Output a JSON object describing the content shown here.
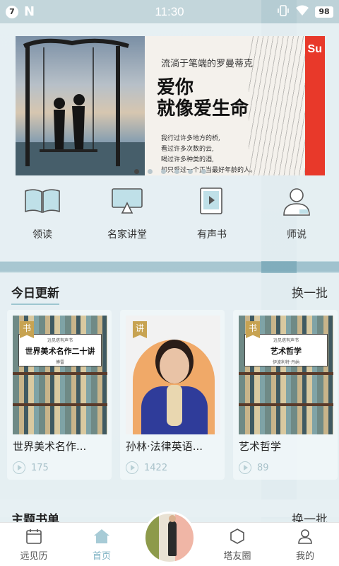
{
  "status_bar": {
    "notification_count": "7",
    "app_letter": "N",
    "time": "11:30",
    "battery": "98"
  },
  "banner": {
    "subtitle": "流淌于笔端的罗曼蒂克",
    "title_line1": "爱你",
    "title_line2": "就像爱生命",
    "poem": [
      "我行过许多地方的桥,",
      "看过许多次数的云,",
      "喝过许多种类的酒,",
      "却只爱过一个正当最好年龄的人。"
    ],
    "side_text": "Su",
    "dots": 6,
    "active_dot": 0
  },
  "quick_nav": [
    {
      "label": "领读",
      "icon": "open-book-icon"
    },
    {
      "label": "名家讲堂",
      "icon": "lecture-screen-icon"
    },
    {
      "label": "有声书",
      "icon": "audio-book-icon"
    },
    {
      "label": "师说",
      "icon": "teacher-icon"
    }
  ],
  "today": {
    "title": "今日更新",
    "action": "换一批",
    "cards": [
      {
        "tag": "书",
        "cover_small": "远见塔有声书",
        "cover_title": "世界美术名作二十讲",
        "cover_author": "傅雷",
        "title": "世界美术名作...",
        "plays": "175"
      },
      {
        "tag": "讲",
        "title": "孙林·法律英语...",
        "plays": "1422"
      },
      {
        "tag": "书",
        "cover_small": "远见塔有声书",
        "cover_title": "艺术哲学",
        "cover_author": "伊波利特·丹纳",
        "title": "艺术哲学",
        "plays": "89"
      }
    ]
  },
  "theme": {
    "title": "主题书单",
    "action": "换一批"
  },
  "bottom_nav": [
    {
      "label": "远见历",
      "icon": "calendar-icon"
    },
    {
      "label": "首页",
      "icon": "home-icon",
      "active": true
    },
    {
      "label": "",
      "icon": "avatar"
    },
    {
      "label": "塔友圈",
      "icon": "hexagon-icon"
    },
    {
      "label": "我的",
      "icon": "user-icon"
    }
  ],
  "colors": {
    "accent": "#7fb3c4",
    "tag": "#c7a352",
    "banner_red": "#e8392a"
  }
}
